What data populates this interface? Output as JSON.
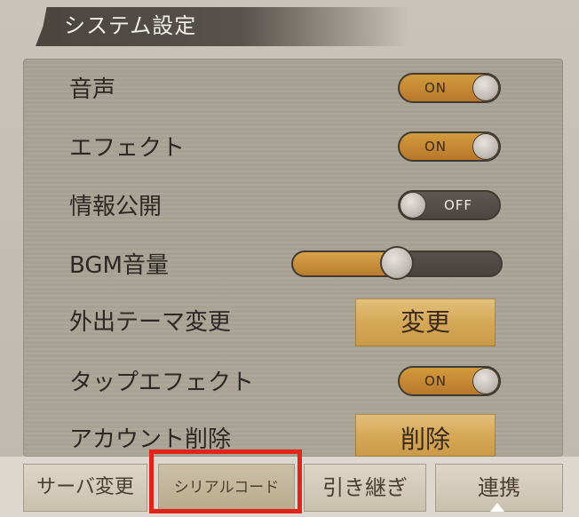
{
  "header": {
    "title": "システム設定"
  },
  "settings": {
    "voice": {
      "label": "音声",
      "state": "ON",
      "value": true
    },
    "effect": {
      "label": "エフェクト",
      "state": "ON",
      "value": true
    },
    "info_public": {
      "label": "情報公開",
      "state": "OFF",
      "value": false
    },
    "bgm_volume": {
      "label": "BGM音量",
      "level": 0.5
    },
    "outing_theme": {
      "label": "外出テーマ変更",
      "button": "変更"
    },
    "tap_effect": {
      "label": "タップエフェクト",
      "state": "ON",
      "value": true
    },
    "account_delete": {
      "label": "アカウント削除",
      "button": "削除"
    }
  },
  "tabs": [
    {
      "label": "サーバ変更",
      "active": false
    },
    {
      "label": "シリアルコード",
      "active": true
    },
    {
      "label": "引き継ぎ",
      "active": false
    },
    {
      "label": "連携",
      "active": false
    }
  ],
  "highlight": {
    "target": "シリアルコード",
    "color": "#e0241b"
  },
  "colors": {
    "accent_gold": "#d39b3c",
    "dark": "#403a33",
    "panel": "#a9a396"
  }
}
